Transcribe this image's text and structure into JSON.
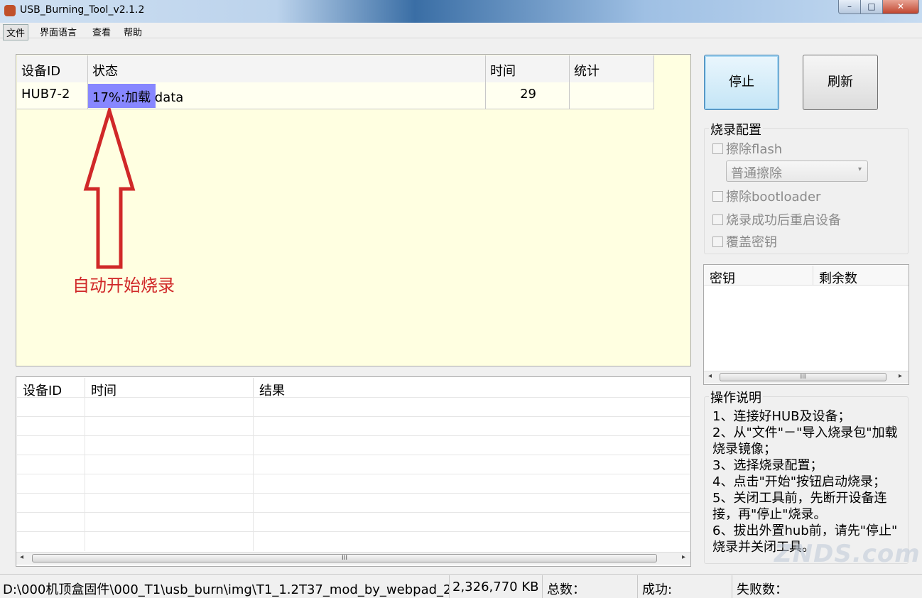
{
  "window": {
    "title": "USB_Burning_Tool_v2.1.2",
    "min": "–",
    "max": "□",
    "close": "✕"
  },
  "menu": {
    "file": "文件",
    "language": "界面语言",
    "view": "查看",
    "help": "帮助"
  },
  "device_table": {
    "headers": [
      "设备ID",
      "状态",
      "时间",
      "统计"
    ],
    "rows": [
      {
        "id": "HUB7-2",
        "status": "17%:加载 data",
        "progress": 0.17,
        "time": "29",
        "stats": ""
      }
    ]
  },
  "annotation": {
    "text": "自动开始烧录",
    "color": "#d02828"
  },
  "result_table": {
    "headers": [
      "设备ID",
      "时间",
      "结果"
    ],
    "scroll_grip": "III",
    "arrow_left": "◂",
    "arrow_right": "▸"
  },
  "buttons": {
    "stop": "停止",
    "refresh": "刷新"
  },
  "burn_config": {
    "title": "烧录配置",
    "erase_flash": "擦除flash",
    "erase_mode": "普通擦除",
    "erase_bootloader": "擦除bootloader",
    "reboot_after": "烧录成功后重启设备",
    "overwrite_key": "覆盖密钥"
  },
  "key_table": {
    "headers": [
      "密钥",
      "剩余数"
    ],
    "scroll_grip": "III",
    "arrow_left": "◂",
    "arrow_right": "▸"
  },
  "instructions": {
    "title": "操作说明",
    "lines": [
      "1、连接好HUB及设备；",
      "2、从\"文件\"－\"导入烧录包\"加载",
      "烧录镜像；",
      "3、选择烧录配置；",
      "4、点击\"开始\"按钮启动烧录；",
      "5、关闭工具前，先断开设备连",
      "接，再\"停止\"烧录。",
      "6、拔出外置hub前，请先\"停止\"",
      "烧录并关闭工具。"
    ]
  },
  "statusbar": {
    "path": "D:\\000机顶盒固件\\000_T1\\usb_burn\\img\\T1_1.2T37_mod_by_webpad_2",
    "size": "2,326,770 KB",
    "total": "总数：",
    "success": "成功:",
    "fail": "失败数："
  },
  "watermark": "ZNDS.com"
}
